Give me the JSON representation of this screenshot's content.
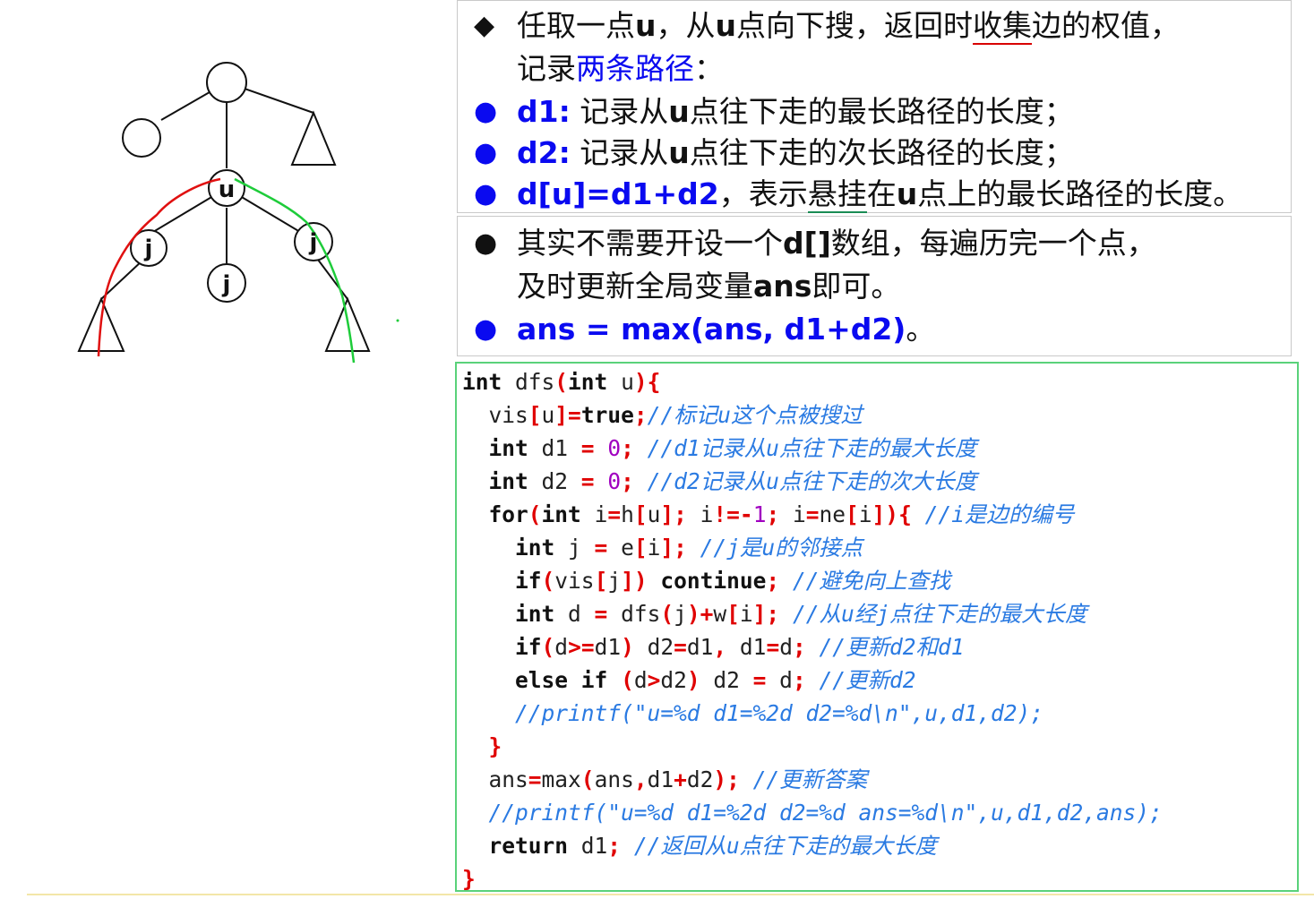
{
  "diagram": {
    "node_u": "u",
    "node_j_left": "j",
    "node_j_mid": "j",
    "node_j_right": "j"
  },
  "box1": {
    "line1_a": "任取一点",
    "line1_u": "u",
    "line1_b": "，从",
    "line1_u2": "u",
    "line1_c": "点向下搜，返回时",
    "line1_d": "收集",
    "line1_e": "边的权值，",
    "line2_a": "记录",
    "line2_b": "两条路径",
    "line2_c": "：",
    "b1_label": "d1:",
    "b1_text_a": " 记录从",
    "b1_u": "u",
    "b1_text_b": "点往下走的最长路径的长度；",
    "b2_label": "d2:",
    "b2_text_a": " 记录从",
    "b2_u": "u",
    "b2_text_b": "点往下走的次长路径的长度；",
    "b3_label": "d[u]=d1+d2",
    "b3_text_a": "，表示",
    "b3_text_b": "悬挂",
    "b3_text_c": "在",
    "b3_u": "u",
    "b3_text_d": "点上的最长路径的长度。"
  },
  "box2": {
    "line1_a": "其实不需要开设一个",
    "line1_d": "d[]",
    "line1_b": "数组，每遍历完一个点，",
    "line2_a": "及时更新全局变量",
    "line2_ans": "ans",
    "line2_b": "即可。",
    "b2_label": "ans = max(ans, d1+d2)",
    "b2_end": "。"
  },
  "code": {
    "l1": [
      "int",
      " dfs",
      "(",
      "int",
      " u",
      ")",
      "{"
    ],
    "l2": [
      "  vis",
      "[",
      "u",
      "]=",
      "true",
      ";",
      "//标记u这个点被搜过"
    ],
    "l3": [
      "  ",
      "int",
      " d1 ",
      "=",
      " ",
      "0",
      ";",
      " //d1记录从u点往下走的最大长度"
    ],
    "l4": [
      "  ",
      "int",
      " d2 ",
      "=",
      " ",
      "0",
      ";",
      " //d2记录从u点往下走的次大长度"
    ],
    "l5": [
      "  ",
      "for",
      "(",
      "int",
      " i",
      "=",
      "h",
      "[",
      "u",
      "];",
      " i",
      "!=-",
      "1",
      ";",
      " i",
      "=",
      "ne",
      "[",
      "i",
      "])",
      "{",
      " //i是边的编号"
    ],
    "l6": [
      "    ",
      "int",
      " j ",
      "=",
      " e",
      "[",
      "i",
      "];",
      " //j是u的邻接点"
    ],
    "l7": [
      "    ",
      "if",
      "(",
      "vis",
      "[",
      "j",
      "])",
      " ",
      "continue",
      ";",
      " //避免向上查找"
    ],
    "l8": [
      "    ",
      "int",
      " d ",
      "=",
      " dfs",
      "(",
      "j",
      ")+",
      "w",
      "[",
      "i",
      "];",
      " //从u经j点往下走的最大长度"
    ],
    "l9": [
      "    ",
      "if",
      "(",
      "d",
      ">=",
      "d1",
      ")",
      " d2",
      "=",
      "d1",
      ",",
      " d1",
      "=",
      "d",
      ";",
      " //更新d2和d1"
    ],
    "l10": [
      "    ",
      "else",
      " ",
      "if",
      " (",
      "d",
      ">",
      "d2",
      ")",
      " d2 ",
      "=",
      " d",
      ";",
      " //更新d2"
    ],
    "l11": [
      "    ",
      "//printf(\"u=%d d1=%2d d2=%d\\n\",u,d1,d2);"
    ],
    "l12": [
      "  ",
      "}"
    ],
    "l13": [
      "  ans",
      "=",
      "max",
      "(",
      "ans",
      ",",
      "d1",
      "+",
      "d2",
      ");",
      " //更新答案"
    ],
    "l14": [
      "  ",
      "//printf(\"u=%d d1=%2d d2=%d ans=%d\\n\",u,d1,d2,ans);"
    ],
    "l15": [
      "  ",
      "return",
      " d1",
      ";",
      " //返回从u点往下走的最大长度"
    ],
    "l16": [
      "}"
    ]
  }
}
